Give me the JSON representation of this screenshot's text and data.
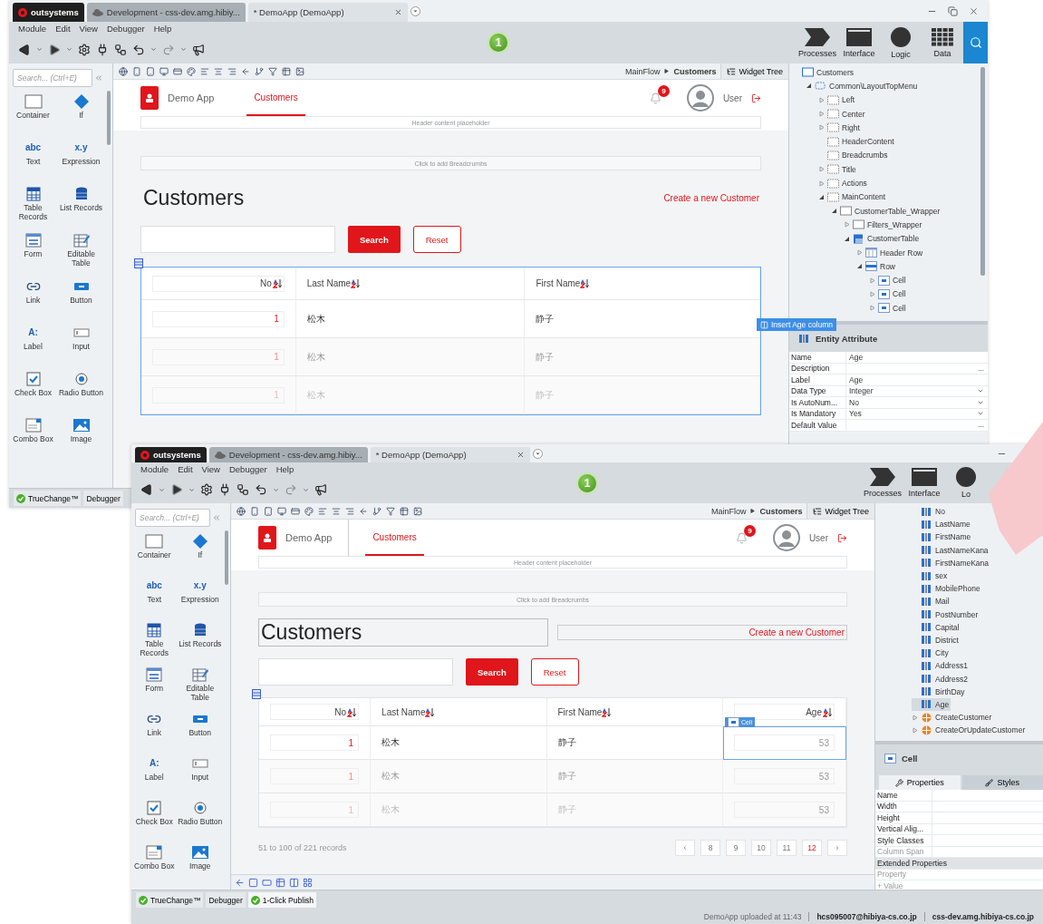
{
  "windows": [
    {
      "tabs": [
        {
          "kind": "logo",
          "label": "outsystems",
          "selected": false
        },
        {
          "kind": "env",
          "label": "Development - css-dev.amg.hibiy...",
          "selected": false
        },
        {
          "kind": "module",
          "label": "* DemoApp (DemoApp)",
          "selected": true
        }
      ],
      "window_controls": [
        {
          "kind": "minimize"
        },
        {
          "kind": "restore"
        },
        {
          "kind": "close"
        }
      ],
      "menu": [
        "Module",
        "Edit",
        "View",
        "Debugger",
        "Help"
      ],
      "badge": "1",
      "areas": [
        {
          "kind": "processes",
          "label": "Processes"
        },
        {
          "kind": "interface",
          "label": "Interface"
        },
        {
          "kind": "logic",
          "label": "Logic"
        },
        {
          "kind": "data",
          "label": "Data"
        }
      ],
      "search_button": true,
      "palette": {
        "placeholder": "Search... (Ctrl+E)",
        "items": [
          {
            "kind": "container",
            "label": "Container"
          },
          {
            "kind": "if",
            "label": "If"
          },
          {
            "kind": "text",
            "glyph": "abc",
            "label": "Text"
          },
          {
            "kind": "expression",
            "glyph": "x.y",
            "label": "Expression"
          },
          {
            "kind": "records",
            "label": "Table Records"
          },
          {
            "kind": "list",
            "label": "List Records"
          },
          {
            "kind": "form",
            "label": "Form"
          },
          {
            "kind": "grid",
            "label": "Editable Table"
          },
          {
            "kind": "link",
            "label": "Link"
          },
          {
            "kind": "button",
            "label": "Button"
          },
          {
            "kind": "label",
            "glyph": "A:",
            "label": "Label"
          },
          {
            "kind": "input",
            "label": "Input"
          },
          {
            "kind": "checkbox",
            "label": "Check Box"
          },
          {
            "kind": "radio",
            "label": "Radio Button"
          },
          {
            "kind": "combo",
            "label": "Combo Box"
          },
          {
            "kind": "image",
            "label": "Image"
          }
        ]
      },
      "breadcrumb": {
        "flow": "MainFlow",
        "screen": "Customers"
      },
      "widget_tree_tab": "Widget Tree",
      "app": {
        "name": "Demo App",
        "menu_item": "Customers",
        "notifications": "9",
        "user": "User",
        "header_placeholder": "Header content placeholder",
        "breadcrumbs_placeholder": "Click to add Breadcrumbs",
        "title": "Customers",
        "create_link": "Create a new Customer",
        "search_label": "Search",
        "reset_label": "Reset",
        "outlined": false,
        "table": {
          "selected": true,
          "columns": [
            {
              "label": "No",
              "kind": "id"
            },
            {
              "label": "Last Name",
              "kind": "text"
            },
            {
              "label": "First Name",
              "kind": "text"
            }
          ],
          "rows": [
            {
              "kind": "live",
              "cells": [
                {
                  "text": "1",
                  "selected": false
                },
                {
                  "text": "松木",
                  "selected": false
                },
                {
                  "text": "静子",
                  "selected": false
                }
              ]
            },
            {
              "kind": "preview",
              "cells": [
                {
                  "text": "1",
                  "selected": false
                },
                {
                  "text": "松木",
                  "selected": false
                },
                {
                  "text": "静子",
                  "selected": false
                }
              ]
            },
            {
              "kind": "ghost",
              "cells": [
                {
                  "text": "1",
                  "selected": false
                },
                {
                  "text": "松木",
                  "selected": false
                },
                {
                  "text": "静子",
                  "selected": false
                }
              ]
            }
          ]
        }
      },
      "drag_hint": "Insert Age column",
      "tree": [
        {
          "label": "Customers",
          "kind": "screen",
          "expandable": false,
          "selected": false,
          "children": [
            {
              "label": "Common\\LayoutTopMenu",
              "kind": "block",
              "expandable": true,
              "expanded": true,
              "selected": false,
              "children": [
                {
                  "label": "Left",
                  "kind": "placeholder",
                  "expandable": true,
                  "expanded": false,
                  "selected": false
                },
                {
                  "label": "Center",
                  "kind": "placeholder",
                  "expandable": true,
                  "expanded": false,
                  "selected": false
                },
                {
                  "label": "Right",
                  "kind": "placeholder",
                  "expandable": true,
                  "expanded": false,
                  "selected": false
                },
                {
                  "label": "HeaderContent",
                  "kind": "placeholder",
                  "expandable": false,
                  "selected": false
                },
                {
                  "label": "Breadcrumbs",
                  "kind": "placeholder",
                  "expandable": false,
                  "selected": false
                },
                {
                  "label": "Title",
                  "kind": "placeholder",
                  "expandable": true,
                  "expanded": false,
                  "selected": false
                },
                {
                  "label": "Actions",
                  "kind": "placeholder",
                  "expandable": true,
                  "expanded": false,
                  "selected": false
                },
                {
                  "label": "MainContent",
                  "kind": "placeholder",
                  "expandable": true,
                  "expanded": true,
                  "selected": false,
                  "children": [
                    {
                      "label": "CustomerTable_Wrapper",
                      "kind": "container",
                      "expandable": true,
                      "expanded": true,
                      "selected": false,
                      "children": [
                        {
                          "label": "Filters_Wrapper",
                          "kind": "container",
                          "expandable": true,
                          "expanded": false,
                          "selected": false
                        },
                        {
                          "label": "CustomerTable",
                          "kind": "table",
                          "expandable": true,
                          "expanded": true,
                          "selected": false,
                          "children": [
                            {
                              "label": "Header Row",
                              "kind": "header-row",
                              "expandable": true,
                              "expanded": false,
                              "selected": false
                            },
                            {
                              "label": "Row",
                              "kind": "row",
                              "expandable": true,
                              "expanded": true,
                              "selected": false,
                              "children": [
                                {
                                  "label": "Cell",
                                  "kind": "cell",
                                  "expandable": true,
                                  "expanded": false,
                                  "selected": false
                                },
                                {
                                  "label": "Cell",
                                  "kind": "cell",
                                  "expandable": true,
                                  "expanded": false,
                                  "selected": false
                                },
                                {
                                  "label": "Cell",
                                  "kind": "cell",
                                  "expandable": true,
                                  "expanded": false,
                                  "selected": false
                                }
                              ]
                            }
                          ]
                        }
                      ]
                    }
                  ]
                }
              ]
            }
          ]
        }
      ],
      "properties": {
        "title": "Entity Attribute",
        "kind": "attribute",
        "rows": [
          {
            "kind": "field",
            "name": "Name",
            "value": "Age",
            "dropdown": false,
            "disabled": false
          },
          {
            "kind": "field",
            "name": "Description",
            "button": "...",
            "dropdown": false,
            "disabled": false
          },
          {
            "kind": "field",
            "name": "Label",
            "value": "Age",
            "dropdown": false,
            "disabled": false
          },
          {
            "kind": "field",
            "name": "Data Type",
            "value": "Integer",
            "dropdown": true,
            "disabled": false
          },
          {
            "kind": "field",
            "name": "Is AutoNum...",
            "value": "No",
            "dropdown": true,
            "disabled": false
          },
          {
            "kind": "field",
            "name": "Is Mandatory",
            "value": "Yes",
            "dropdown": true,
            "disabled": false
          },
          {
            "kind": "field",
            "name": "Default Value",
            "button": "...",
            "dropdown": false,
            "disabled": false
          }
        ]
      },
      "bottom_tabs": [
        {
          "label": "TrueChange™",
          "kind": "check",
          "selected": false
        },
        {
          "label": "Debugger",
          "kind": "plain",
          "selected": false
        }
      ]
    },
    {
      "tabs": [
        {
          "kind": "logo",
          "label": "outsystems",
          "selected": false
        },
        {
          "kind": "env",
          "label": "Development - css-dev.amg.hibiy...",
          "selected": false
        },
        {
          "kind": "module",
          "label": "* DemoApp (DemoApp)",
          "selected": true
        }
      ],
      "window_controls": [
        {
          "kind": "minimize"
        }
      ],
      "menu": [
        "Module",
        "Edit",
        "View",
        "Debugger",
        "Help"
      ],
      "badge": "1",
      "areas": [
        {
          "kind": "processes",
          "label": "Processes"
        },
        {
          "kind": "interface",
          "label": "Interface"
        },
        {
          "kind": "logic",
          "label": "Lo"
        }
      ],
      "search_button": false,
      "palette": {
        "placeholder": "Search... (Ctrl+E)",
        "items": [
          {
            "kind": "container",
            "label": "Container"
          },
          {
            "kind": "if",
            "label": "If"
          },
          {
            "kind": "text",
            "glyph": "abc",
            "label": "Text"
          },
          {
            "kind": "expression",
            "glyph": "x.y",
            "label": "Expression"
          },
          {
            "kind": "records",
            "label": "Table Records"
          },
          {
            "kind": "list",
            "label": "List Records"
          },
          {
            "kind": "form",
            "label": "Form"
          },
          {
            "kind": "grid",
            "label": "Editable Table"
          },
          {
            "kind": "link",
            "label": "Link"
          },
          {
            "kind": "button",
            "label": "Button"
          },
          {
            "kind": "label",
            "glyph": "A:",
            "label": "Label"
          },
          {
            "kind": "input",
            "label": "Input"
          },
          {
            "kind": "checkbox",
            "label": "Check Box"
          },
          {
            "kind": "radio",
            "label": "Radio Button"
          },
          {
            "kind": "combo",
            "label": "Combo Box"
          },
          {
            "kind": "image",
            "label": "Image"
          }
        ]
      },
      "breadcrumb": {
        "flow": "MainFlow",
        "screen": "Customers"
      },
      "widget_tree_tab": "Widget Tree",
      "app": {
        "name": "Demo App",
        "menu_item": "Customers",
        "notifications": "9",
        "user": "User",
        "header_placeholder": "Header content placeholder",
        "breadcrumbs_placeholder": "Click to add Breadcrumbs",
        "title": "Customers",
        "create_link": "Create a new Customer",
        "search_label": "Search",
        "reset_label": "Reset",
        "outlined": true,
        "table": {
          "selected": false,
          "selection_tag": "Cell",
          "columns": [
            {
              "label": "No",
              "kind": "id"
            },
            {
              "label": "Last Name",
              "kind": "text"
            },
            {
              "label": "First Name",
              "kind": "text"
            },
            {
              "label": "Age",
              "kind": "number"
            }
          ],
          "rows": [
            {
              "kind": "live",
              "cells": [
                {
                  "text": "1",
                  "selected": false
                },
                {
                  "text": "松木",
                  "selected": false
                },
                {
                  "text": "静子",
                  "selected": false
                },
                {
                  "text": "53",
                  "selected": true
                }
              ]
            },
            {
              "kind": "preview",
              "cells": [
                {
                  "text": "1",
                  "selected": false
                },
                {
                  "text": "松木",
                  "selected": false
                },
                {
                  "text": "静子",
                  "selected": false
                },
                {
                  "text": "53",
                  "selected": false
                }
              ]
            },
            {
              "kind": "ghost",
              "cells": [
                {
                  "text": "1",
                  "selected": false
                },
                {
                  "text": "松木",
                  "selected": false
                },
                {
                  "text": "静子",
                  "selected": false
                },
                {
                  "text": "53",
                  "selected": false
                }
              ]
            }
          ]
        },
        "pagination": {
          "summary": "51 to 100 of 221 records",
          "pages": [
            {
              "label": "‹",
              "selected": false
            },
            {
              "label": "8",
              "selected": false
            },
            {
              "label": "9",
              "selected": false
            },
            {
              "label": "10",
              "selected": false
            },
            {
              "label": "11",
              "selected": false
            },
            {
              "label": "12",
              "selected": true
            },
            {
              "label": "›",
              "selected": false
            }
          ]
        }
      },
      "view_switcher": true,
      "tree": [
        {
          "label": "No",
          "kind": "attribute",
          "expandable": false,
          "selected": false
        },
        {
          "label": "LastName",
          "kind": "attribute",
          "expandable": false,
          "selected": false
        },
        {
          "label": "FirstName",
          "kind": "attribute",
          "expandable": false,
          "selected": false
        },
        {
          "label": "LastNameKana",
          "kind": "attribute",
          "expandable": false,
          "selected": false
        },
        {
          "label": "FirstNameKana",
          "kind": "attribute",
          "expandable": false,
          "selected": false
        },
        {
          "label": "sex",
          "kind": "attribute",
          "expandable": false,
          "selected": false
        },
        {
          "label": "MobilePhone",
          "kind": "attribute",
          "expandable": false,
          "selected": false
        },
        {
          "label": "Mail",
          "kind": "attribute",
          "expandable": false,
          "selected": false
        },
        {
          "label": "PostNumber",
          "kind": "attribute",
          "expandable": false,
          "selected": false
        },
        {
          "label": "Capital",
          "kind": "attribute",
          "expandable": false,
          "selected": false
        },
        {
          "label": "District",
          "kind": "attribute",
          "expandable": false,
          "selected": false
        },
        {
          "label": "City",
          "kind": "attribute",
          "expandable": false,
          "selected": false
        },
        {
          "label": "Address1",
          "kind": "attribute",
          "expandable": false,
          "selected": false
        },
        {
          "label": "Address2",
          "kind": "attribute",
          "expandable": false,
          "selected": false
        },
        {
          "label": "BirthDay",
          "kind": "attribute",
          "expandable": false,
          "selected": false
        },
        {
          "label": "Age",
          "kind": "attribute",
          "expandable": false,
          "selected": true
        },
        {
          "label": "CreateCustomer",
          "kind": "action",
          "expandable": true,
          "expanded": false,
          "selected": false
        },
        {
          "label": "CreateOrUpdateCustomer",
          "kind": "action",
          "expandable": true,
          "expanded": false,
          "selected": false
        }
      ],
      "properties": {
        "title": "Cell",
        "kind": "cell",
        "tabs": [
          {
            "label": "Properties",
            "kind": "wrench",
            "selected": true
          },
          {
            "label": "Styles",
            "kind": "brush",
            "selected": false
          }
        ],
        "rows": [
          {
            "kind": "field",
            "name": "Name",
            "dropdown": false,
            "disabled": false
          },
          {
            "kind": "field",
            "name": "Width",
            "dropdown": false,
            "disabled": false
          },
          {
            "kind": "field",
            "name": "Height",
            "dropdown": false,
            "disabled": false
          },
          {
            "kind": "field",
            "name": "Vertical Alig...",
            "dropdown": false,
            "disabled": false
          },
          {
            "kind": "field",
            "name": "Style Classes",
            "dropdown": false,
            "disabled": false
          },
          {
            "kind": "field",
            "name": "Column Span",
            "dropdown": false,
            "disabled": true
          },
          {
            "kind": "section",
            "name": "Extended Properties"
          },
          {
            "kind": "placeholder",
            "name": "Property"
          },
          {
            "kind": "placeholder",
            "name": "+ Value"
          }
        ]
      },
      "bottom_tabs": [
        {
          "label": "TrueChange™",
          "kind": "check",
          "selected": false
        },
        {
          "label": "Debugger",
          "kind": "plain",
          "selected": false
        },
        {
          "label": "1-Click Publish",
          "kind": "check",
          "selected": true
        }
      ],
      "status": [
        {
          "text": "DemoApp uploaded at 11:43",
          "kind": "note"
        },
        {
          "text": "hcs095007@hibiya-cs.co.jp",
          "kind": "account"
        },
        {
          "text": "css-dev.amg.hibiya-cs.co.jp",
          "kind": "server"
        }
      ]
    }
  ]
}
